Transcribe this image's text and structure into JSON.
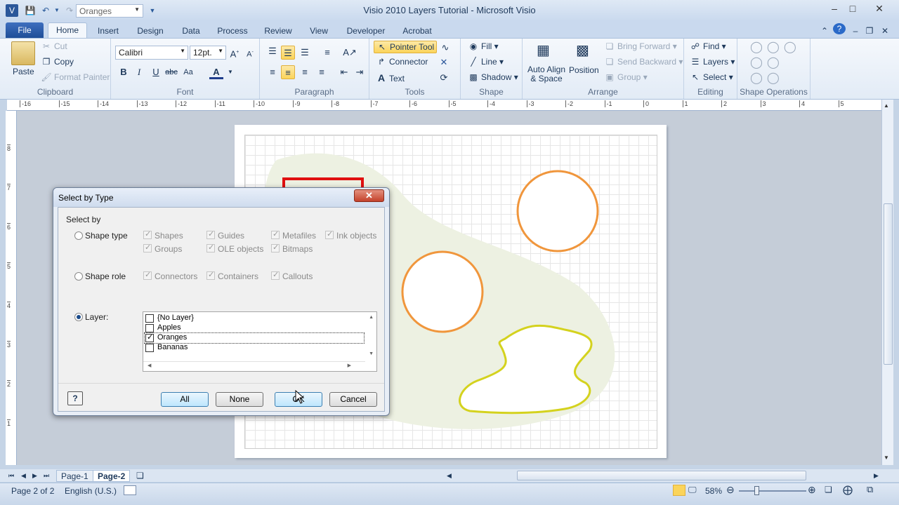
{
  "window": {
    "title": "Visio 2010 Layers Tutorial - Microsoft Visio"
  },
  "quick_access": {
    "combo_value": "Oranges"
  },
  "tabs": [
    "File",
    "Home",
    "Insert",
    "Design",
    "Data",
    "Process",
    "Review",
    "View",
    "Developer",
    "Acrobat"
  ],
  "ribbon": {
    "clipboard": {
      "label": "Clipboard",
      "paste": "Paste",
      "cut": "Cut",
      "copy": "Copy",
      "format_painter": "Format Painter"
    },
    "font": {
      "label": "Font",
      "family": "Calibri",
      "size": "12pt."
    },
    "paragraph": {
      "label": "Paragraph"
    },
    "tools": {
      "label": "Tools",
      "pointer": "Pointer Tool",
      "connector": "Connector",
      "text": "Text"
    },
    "shape": {
      "label": "Shape",
      "fill": "Fill",
      "line": "Line",
      "shadow": "Shadow"
    },
    "arrange": {
      "label": "Arrange",
      "auto_align": "Auto Align",
      "and_space": "& Space",
      "position": "Position",
      "bring_forward": "Bring Forward",
      "send_backward": "Send Backward",
      "group": "Group"
    },
    "editing": {
      "label": "Editing",
      "find": "Find",
      "layers": "Layers",
      "select": "Select"
    },
    "shape_ops": {
      "label": "Shape Operations"
    }
  },
  "ruler_h": [
    "-16",
    "-15",
    "-14",
    "-13",
    "-12",
    "-11",
    "-10",
    "-9",
    "-8",
    "-7",
    "-6",
    "-5",
    "-4",
    "-3",
    "-2",
    "-1",
    "0",
    "1",
    "2",
    "3",
    "4",
    "5"
  ],
  "ruler_v": [
    "8",
    "7",
    "6",
    "5",
    "4",
    "3",
    "2",
    "1"
  ],
  "dialog": {
    "title": "Select by Type",
    "select_by": "Select by",
    "shape_type": "Shape type",
    "shape_role": "Shape role",
    "layer": "Layer:",
    "type_options": [
      "Shapes",
      "Guides",
      "Metafiles",
      "Ink objects",
      "Groups",
      "OLE objects",
      "Bitmaps"
    ],
    "role_options": [
      "Connectors",
      "Containers",
      "Callouts"
    ],
    "layers": [
      {
        "name": "{No Layer}",
        "checked": false
      },
      {
        "name": "Apples",
        "checked": false
      },
      {
        "name": "Oranges",
        "checked": true
      },
      {
        "name": "Bananas",
        "checked": false
      }
    ],
    "buttons": {
      "all": "All",
      "none": "None",
      "ok": "OK",
      "cancel": "Cancel"
    }
  },
  "pages": {
    "page1": "Page-1",
    "page2": "Page-2"
  },
  "status": {
    "page_info": "Page 2 of 2",
    "language": "English (U.S.)",
    "zoom": "58%"
  },
  "colors": {
    "orange": "#f0963c",
    "yellow": "#d4d21e",
    "red_box": "#e01010",
    "blob": "#edf1e2"
  }
}
